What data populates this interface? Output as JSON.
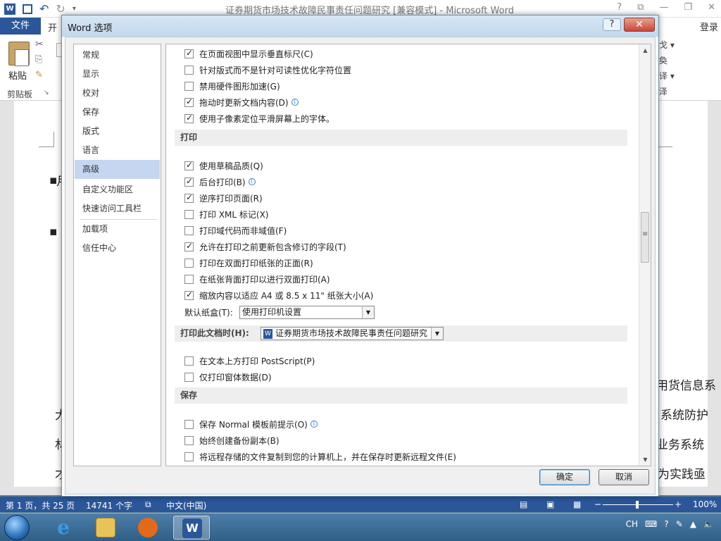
{
  "word": {
    "title": "证券期货市场技术故障民事责任问题研究 [兼容模式] - Microsoft Word",
    "file_tab": "文件",
    "start_tab_partial": "开",
    "login": "登录",
    "paste_label": "粘贴",
    "clipboard_label": "剪贴板",
    "ribbon_right_fragments": [
      "戈 ▾",
      "奐",
      "译 ▾",
      "泽"
    ],
    "doc_fragments": [
      "用货信息系",
      "系统防护",
      "业务系统",
      "为实践亟"
    ],
    "doc_left_fragments": [
      "月",
      "大",
      "林",
      "才"
    ]
  },
  "status": {
    "page": "第 1 页，共 25 页",
    "words": "14741 个字",
    "language": "中文(中国)",
    "zoom": "100%"
  },
  "dialog": {
    "title": "Word 选项",
    "help": "?",
    "close": "✕",
    "nav_items": [
      "常规",
      "显示",
      "校对",
      "保存",
      "版式",
      "语言",
      "高级",
      "自定义功能区",
      "快速访问工具栏",
      "加载项",
      "信任中心"
    ],
    "selected_nav": "高级",
    "display_options": [
      {
        "label": "在页面视图中显示垂直标尺(C)",
        "checked": true
      },
      {
        "label": "针对版式而不是针对可读性优化字符位置",
        "checked": false
      },
      {
        "label": "禁用硬件图形加速(G)",
        "checked": false
      },
      {
        "label": "拖动时更新文档内容(D)",
        "checked": true,
        "info": true
      },
      {
        "label": "使用子像素定位平滑屏幕上的字体。",
        "checked": true
      }
    ],
    "print_section": "打印",
    "print_options": [
      {
        "label": "使用草稿品质(Q)",
        "checked": true
      },
      {
        "label": "后台打印(B)",
        "checked": true,
        "info": true
      },
      {
        "label": "逆序打印页面(R)",
        "checked": true
      },
      {
        "label": "打印 XML 标记(X)",
        "checked": false
      },
      {
        "label": "打印域代码而非域值(F)",
        "checked": false
      },
      {
        "label": "允许在打印之前更新包含修订的字段(T)",
        "checked": true
      },
      {
        "label": "打印在双面打印纸张的正面(R)",
        "checked": false
      },
      {
        "label": "在纸张背面打印以进行双面打印(A)",
        "checked": false
      },
      {
        "label": "缩放内容以适应 A4 或 8.5 x 11\" 纸张大小(A)",
        "checked": true
      }
    ],
    "default_tray_label": "默认纸盒(T):",
    "default_tray_value": "使用打印机设置",
    "print_doc_section": "打印此文档时(H):",
    "print_doc_value": "证券期货市场技术故障民事责任问题研究",
    "print_doc_options": [
      {
        "label": "在文本上方打印 PostScript(P)",
        "checked": false
      },
      {
        "label": "仅打印窗体数据(D)",
        "checked": false
      }
    ],
    "save_section": "保存",
    "save_options": [
      {
        "label": "保存 Normal 模板前提示(O)",
        "checked": false,
        "info": true
      },
      {
        "label": "始终创建备份副本(B)",
        "checked": false
      },
      {
        "label": "将远程存储的文件复制到您的计算机上，并在保存时更新远程文件(E)",
        "checked": false
      }
    ],
    "ok": "确定",
    "cancel": "取消"
  },
  "tray": {
    "lang": "CH",
    "time_hidden": ""
  },
  "colors": {
    "word_blue": "#2b579a",
    "nav_selected": "#c5d6f1",
    "close_red": "#c8473a"
  }
}
